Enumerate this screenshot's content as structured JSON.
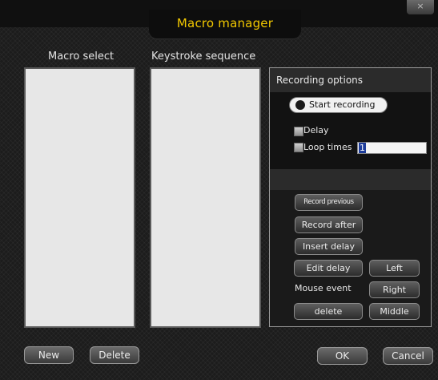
{
  "window": {
    "title": "Macro manager",
    "close_glyph": "×"
  },
  "columns": {
    "macro_select": "Macro select",
    "keystroke_sequence": "Keystroke sequence"
  },
  "recording": {
    "header": "Recording options",
    "start_label": "Start recording",
    "delay_label": "Delay",
    "loop_label": "Loop times",
    "loop_value": "1"
  },
  "buttons": {
    "record_previous": "Record previous",
    "record_after": "Record after",
    "insert_delay": "Insert delay",
    "edit_delay": "Edit delay",
    "left": "Left",
    "mouse_event": "Mouse event",
    "right": "Right",
    "delete": "delete",
    "middle": "Middle"
  },
  "footer": {
    "new": "New",
    "delete": "Delete",
    "ok": "OK",
    "cancel": "Cancel"
  },
  "icons": {
    "close": "close-icon",
    "record": "record-dot-icon"
  },
  "colors": {
    "title": "#f2c800",
    "background": "#1c1c1c",
    "selection": "#1d3c9a"
  }
}
